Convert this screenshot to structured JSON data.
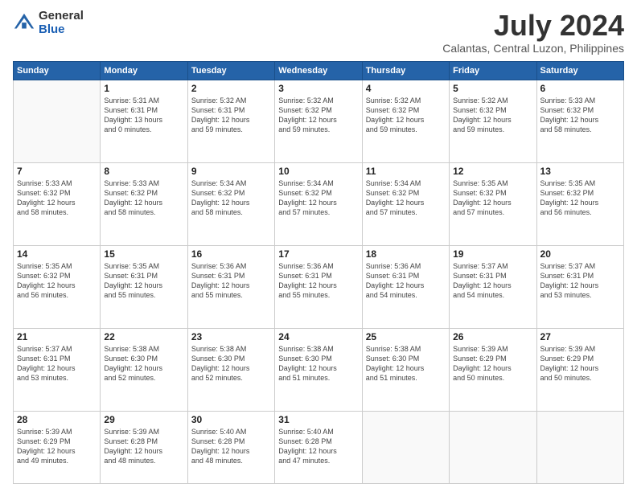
{
  "logo": {
    "general": "General",
    "blue": "Blue"
  },
  "header": {
    "month": "July 2024",
    "location": "Calantas, Central Luzon, Philippines"
  },
  "weekdays": [
    "Sunday",
    "Monday",
    "Tuesday",
    "Wednesday",
    "Thursday",
    "Friday",
    "Saturday"
  ],
  "weeks": [
    [
      {
        "day": "",
        "info": ""
      },
      {
        "day": "1",
        "info": "Sunrise: 5:31 AM\nSunset: 6:31 PM\nDaylight: 13 hours\nand 0 minutes."
      },
      {
        "day": "2",
        "info": "Sunrise: 5:32 AM\nSunset: 6:31 PM\nDaylight: 12 hours\nand 59 minutes."
      },
      {
        "day": "3",
        "info": "Sunrise: 5:32 AM\nSunset: 6:32 PM\nDaylight: 12 hours\nand 59 minutes."
      },
      {
        "day": "4",
        "info": "Sunrise: 5:32 AM\nSunset: 6:32 PM\nDaylight: 12 hours\nand 59 minutes."
      },
      {
        "day": "5",
        "info": "Sunrise: 5:32 AM\nSunset: 6:32 PM\nDaylight: 12 hours\nand 59 minutes."
      },
      {
        "day": "6",
        "info": "Sunrise: 5:33 AM\nSunset: 6:32 PM\nDaylight: 12 hours\nand 58 minutes."
      }
    ],
    [
      {
        "day": "7",
        "info": "Sunrise: 5:33 AM\nSunset: 6:32 PM\nDaylight: 12 hours\nand 58 minutes."
      },
      {
        "day": "8",
        "info": "Sunrise: 5:33 AM\nSunset: 6:32 PM\nDaylight: 12 hours\nand 58 minutes."
      },
      {
        "day": "9",
        "info": "Sunrise: 5:34 AM\nSunset: 6:32 PM\nDaylight: 12 hours\nand 58 minutes."
      },
      {
        "day": "10",
        "info": "Sunrise: 5:34 AM\nSunset: 6:32 PM\nDaylight: 12 hours\nand 57 minutes."
      },
      {
        "day": "11",
        "info": "Sunrise: 5:34 AM\nSunset: 6:32 PM\nDaylight: 12 hours\nand 57 minutes."
      },
      {
        "day": "12",
        "info": "Sunrise: 5:35 AM\nSunset: 6:32 PM\nDaylight: 12 hours\nand 57 minutes."
      },
      {
        "day": "13",
        "info": "Sunrise: 5:35 AM\nSunset: 6:32 PM\nDaylight: 12 hours\nand 56 minutes."
      }
    ],
    [
      {
        "day": "14",
        "info": "Sunrise: 5:35 AM\nSunset: 6:32 PM\nDaylight: 12 hours\nand 56 minutes."
      },
      {
        "day": "15",
        "info": "Sunrise: 5:35 AM\nSunset: 6:31 PM\nDaylight: 12 hours\nand 55 minutes."
      },
      {
        "day": "16",
        "info": "Sunrise: 5:36 AM\nSunset: 6:31 PM\nDaylight: 12 hours\nand 55 minutes."
      },
      {
        "day": "17",
        "info": "Sunrise: 5:36 AM\nSunset: 6:31 PM\nDaylight: 12 hours\nand 55 minutes."
      },
      {
        "day": "18",
        "info": "Sunrise: 5:36 AM\nSunset: 6:31 PM\nDaylight: 12 hours\nand 54 minutes."
      },
      {
        "day": "19",
        "info": "Sunrise: 5:37 AM\nSunset: 6:31 PM\nDaylight: 12 hours\nand 54 minutes."
      },
      {
        "day": "20",
        "info": "Sunrise: 5:37 AM\nSunset: 6:31 PM\nDaylight: 12 hours\nand 53 minutes."
      }
    ],
    [
      {
        "day": "21",
        "info": "Sunrise: 5:37 AM\nSunset: 6:31 PM\nDaylight: 12 hours\nand 53 minutes."
      },
      {
        "day": "22",
        "info": "Sunrise: 5:38 AM\nSunset: 6:30 PM\nDaylight: 12 hours\nand 52 minutes."
      },
      {
        "day": "23",
        "info": "Sunrise: 5:38 AM\nSunset: 6:30 PM\nDaylight: 12 hours\nand 52 minutes."
      },
      {
        "day": "24",
        "info": "Sunrise: 5:38 AM\nSunset: 6:30 PM\nDaylight: 12 hours\nand 51 minutes."
      },
      {
        "day": "25",
        "info": "Sunrise: 5:38 AM\nSunset: 6:30 PM\nDaylight: 12 hours\nand 51 minutes."
      },
      {
        "day": "26",
        "info": "Sunrise: 5:39 AM\nSunset: 6:29 PM\nDaylight: 12 hours\nand 50 minutes."
      },
      {
        "day": "27",
        "info": "Sunrise: 5:39 AM\nSunset: 6:29 PM\nDaylight: 12 hours\nand 50 minutes."
      }
    ],
    [
      {
        "day": "28",
        "info": "Sunrise: 5:39 AM\nSunset: 6:29 PM\nDaylight: 12 hours\nand 49 minutes."
      },
      {
        "day": "29",
        "info": "Sunrise: 5:39 AM\nSunset: 6:28 PM\nDaylight: 12 hours\nand 48 minutes."
      },
      {
        "day": "30",
        "info": "Sunrise: 5:40 AM\nSunset: 6:28 PM\nDaylight: 12 hours\nand 48 minutes."
      },
      {
        "day": "31",
        "info": "Sunrise: 5:40 AM\nSunset: 6:28 PM\nDaylight: 12 hours\nand 47 minutes."
      },
      {
        "day": "",
        "info": ""
      },
      {
        "day": "",
        "info": ""
      },
      {
        "day": "",
        "info": ""
      }
    ]
  ]
}
